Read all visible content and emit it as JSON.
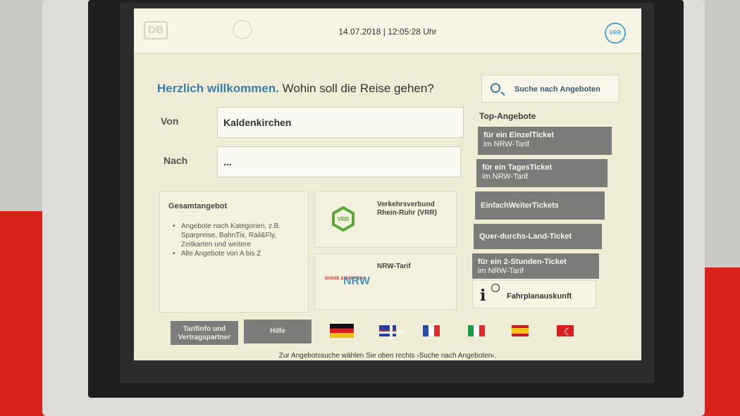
{
  "header": {
    "datetime": "14.07.2018 | 12:05:28 Uhr",
    "db_logo": "DB",
    "vrr_logo": "VRR"
  },
  "welcome": {
    "strong": "Herzlich willkommen.",
    "rest": " Wohin soll die Reise gehen?"
  },
  "search": {
    "label": "Suche nach Angeboten"
  },
  "form": {
    "from_label": "Von",
    "from_value": "Kaldenkirchen",
    "to_label": "Nach",
    "to_value": "..."
  },
  "top_offers": {
    "title": "Top-Angebote",
    "items": [
      {
        "label": "für ein EinzelTicket",
        "sub": "im NRW-Tarif"
      },
      {
        "label": "für ein TagesTicket",
        "sub": "im NRW-Tarif"
      },
      {
        "label": "EinfachWeiterTickets",
        "sub": ""
      },
      {
        "label": "Quer-durchs-Land-Ticket",
        "sub": ""
      },
      {
        "label": "für ein 2-Stunden-Ticket",
        "sub": "im NRW-Tarif"
      }
    ],
    "info_label": "Fahrplanauskunft"
  },
  "gesamtangebot": {
    "title": "Gesamtangebot",
    "items": [
      "Angebote nach Kategorien, z.B. Sparpreise, BahnTix, Rail&Fly, Zeitkarten und weitere",
      "Alle Angebote von A bis Z"
    ]
  },
  "vrr_panel": {
    "title": "Verkehrsverbund Rhein-Ruhr (VRR)",
    "logo": "VRR"
  },
  "nrw_panel": {
    "title": "NRW-Tarif",
    "logo_small": "BUSSE & BAHNEN",
    "logo_big": "NRW"
  },
  "bottom": {
    "tarifinfo": "Tarifinfo und Vertragspartner",
    "hilfe": "Hilfe"
  },
  "flags": [
    "de",
    "uk",
    "fr",
    "it",
    "es",
    "tr"
  ],
  "footer_hint": "Zur Angebotssuche wählen Sie oben rechts ›Suche nach Angeboten‹.",
  "colors": {
    "accent_blue": "#3c7fa6",
    "button_grey": "#7b7b79",
    "screen_bg": "#efedd5",
    "machine_red": "#d8231c",
    "vrr_green": "#5aa838"
  }
}
